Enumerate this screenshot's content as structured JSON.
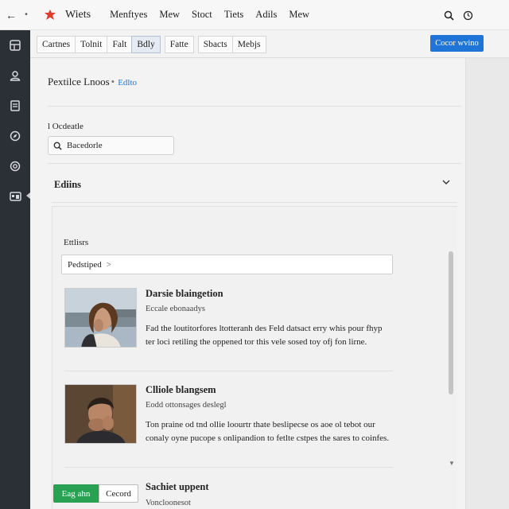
{
  "topbar": {
    "app_title": "Wiets",
    "menu": [
      "Menftyes",
      "Mew",
      "Stoct",
      "Tiets",
      "Adils",
      "Mew"
    ],
    "icons": [
      "back-arrow-icon",
      "more-dots-icon",
      "app-logo-icon",
      "search-icon",
      "clock-icon"
    ]
  },
  "sidebar": {
    "items": [
      "dashboard-icon",
      "user-icon",
      "document-icon",
      "compass-icon",
      "target-icon",
      "gallery-icon"
    ]
  },
  "tabbar": {
    "tabs": [
      "Cartnes",
      "Tolnit",
      "Falt",
      "Bdly",
      "Fatte",
      "Sbacts",
      "Mebjs"
    ],
    "active_tab": "Bdly",
    "primary_button": "Cocor wvino"
  },
  "main": {
    "page_title": "Pextilce Lnoos",
    "page_separator": "•",
    "page_edit_link": "Edlto",
    "search_label": "l Ocdeatle",
    "search_value": "Bacedorle",
    "section_title": "Ediins",
    "panel": {
      "label": "Ettlisrs",
      "input_value": "Pedstiped",
      "input_chevron": ">"
    },
    "cards": [
      {
        "name": "Darsie blaingetion",
        "sub": "Eccale ebonaadys",
        "desc": "Fad the loutitorfores ltotteranh des Feld datsact erry whis pour fhyp ter loci retiling the oppened tor this vele sosed toy ofj fon lirne.",
        "photo": "woman-portrait-photo"
      },
      {
        "name": "Clliole blangsem",
        "sub": "Eodd ottonsages deslegl",
        "desc": "Ton praine od tnd ollie loourtr thate beslipecse os aoe ol tebot our conaly oyne pucope s onlipandion to fetlte cstpes the sares to coinfes.",
        "photo": "man-portrait-photo"
      }
    ],
    "footer": {
      "green_button": "Eag ahn",
      "cancel_button": "Cecord",
      "title": "Sachiet uppent",
      "sub": "Voncloonesot"
    }
  },
  "colors": {
    "accent": "#1f74d8",
    "success": "#29a152",
    "sidebar": "#2b3036",
    "logo": "#e23b2e"
  }
}
